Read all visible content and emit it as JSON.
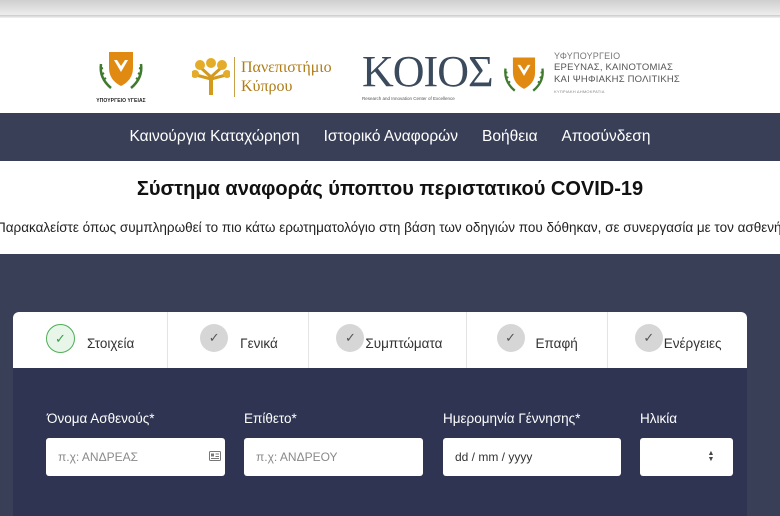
{
  "header": {
    "moh_caption": "ΥΠΟΥΡΓΕΙΟ ΥΓΕΙΑΣ",
    "ucy_line1": "Πανεπιστήμιο",
    "ucy_line2": "Κύπρου",
    "koios_word": "KOΙOΣ",
    "koios_sub": "Research and Innovation Center of Excellence",
    "dmrid_line1": "ΥΦΥΠΟΥΡΓΕΙΟ",
    "dmrid_line2": "ΕΡΕΥΝΑΣ, ΚΑΙΝΟΤΟΜΙΑΣ",
    "dmrid_line3": "ΚΑΙ ΨΗΦΙΑΚΗΣ ΠΟΛΙΤΙΚΗΣ",
    "dmrid_line4": "ΚΥΠΡΙΑΚΗ ΔΗΜΟΚΡΑΤΙΑ"
  },
  "nav": {
    "items": [
      {
        "label": "Καινούργια Καταχώρηση"
      },
      {
        "label": "Ιστορικό Αναφορών"
      },
      {
        "label": "Βοήθεια"
      },
      {
        "label": "Αποσύνδεση"
      }
    ]
  },
  "page": {
    "title": "Σύστημα αναφοράς ύποπτου περιστατικού COVID-19",
    "subtitle": "Παρακαλείστε όπως συμπληρωθεί το πιο κάτω ερωτηματολόγιο στη βάση των οδηγιών που δόθηκαν, σε συνεργασία με τον ασθενή."
  },
  "steps": [
    {
      "label": "Στοιχεία",
      "state": "active",
      "icon": "check-icon"
    },
    {
      "label": "Γενικά",
      "state": "pending",
      "icon": "check-icon"
    },
    {
      "label": "Συμπτώματα",
      "state": "pending",
      "icon": "check-icon"
    },
    {
      "label": "Επαφή",
      "state": "pending",
      "icon": "check-icon"
    },
    {
      "label": "Ενέργειες",
      "state": "pending",
      "icon": "check-icon"
    }
  ],
  "form": {
    "first_name": {
      "label": "Όνομα Ασθενούς*",
      "placeholder": "π.χ: ΑΝΔΡΕΑΣ",
      "value": ""
    },
    "last_name": {
      "label": "Επίθετο*",
      "placeholder": "π.χ: ΑΝΔΡΕΟΥ",
      "value": ""
    },
    "dob": {
      "label": "Ημερομηνία Γέννησης*",
      "placeholder": "dd / mm / yyyy"
    },
    "age": {
      "label": "Ηλικία",
      "value": ""
    }
  },
  "colors": {
    "nav_bg": "#3a3f58",
    "form_bg": "#2e3451",
    "step_done": "#4fae57",
    "ucy_gold": "#b07c17",
    "koios_red": "#c9302c"
  }
}
